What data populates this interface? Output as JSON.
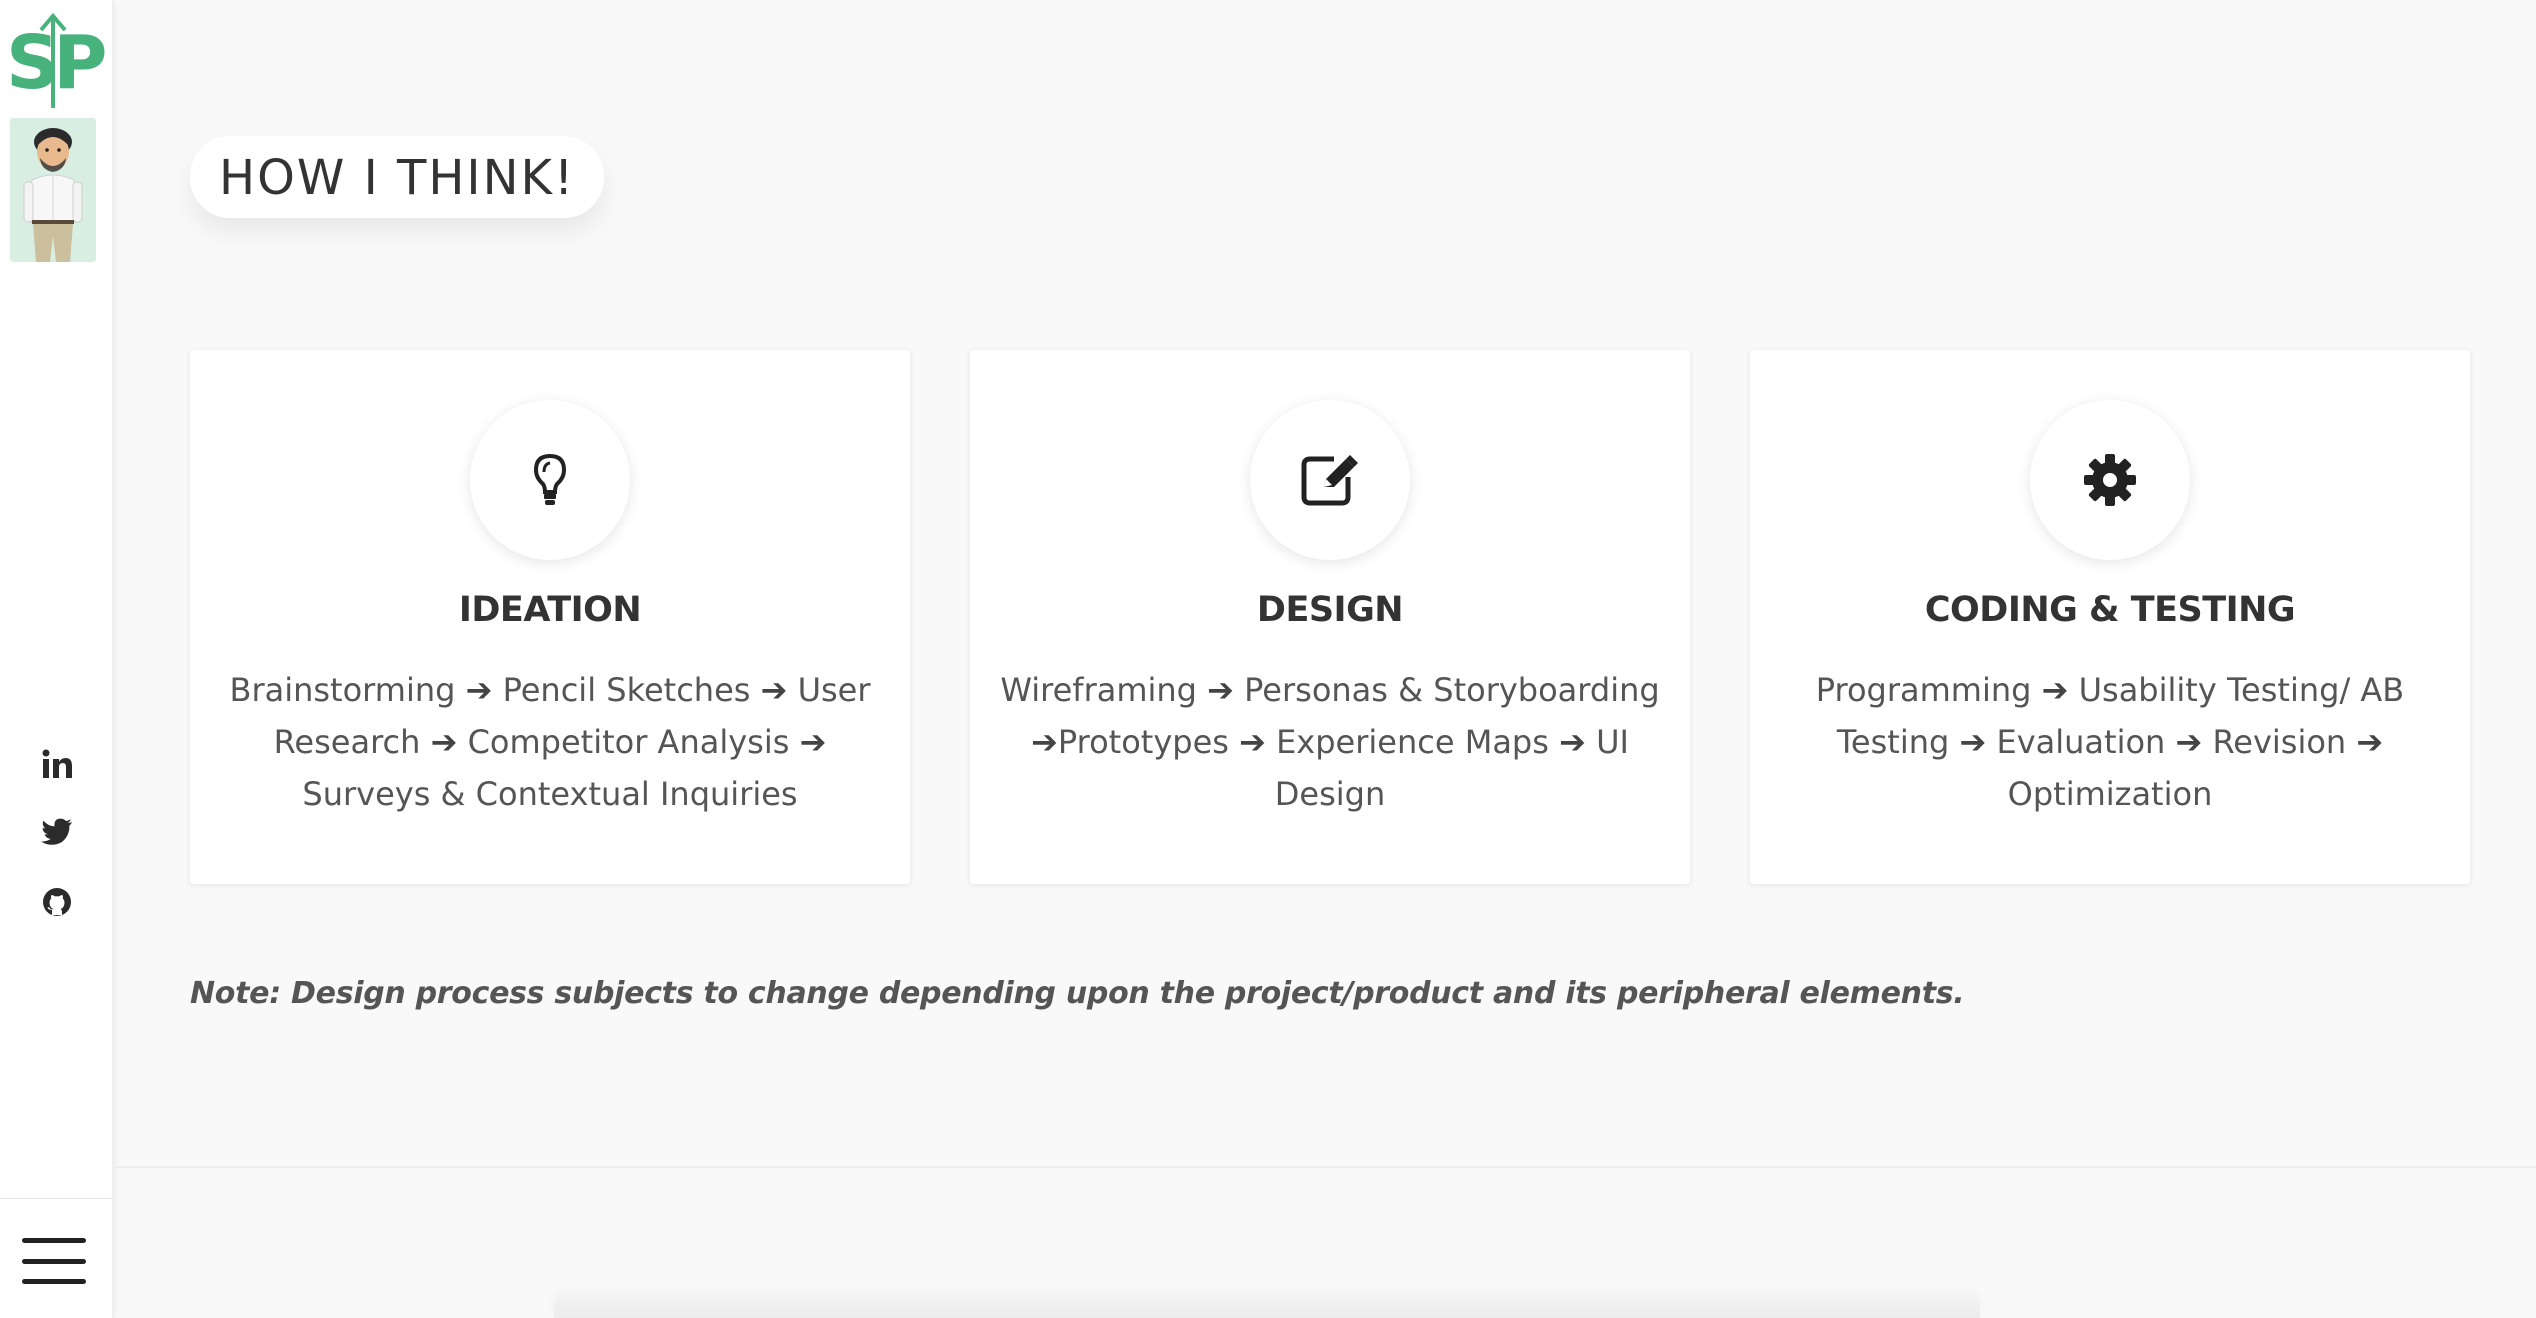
{
  "brand": {
    "logo_text": "SP",
    "accent_color": "#47b27b"
  },
  "sidebar": {
    "social": [
      {
        "name": "linkedin",
        "icon": "linkedin-icon"
      },
      {
        "name": "twitter",
        "icon": "twitter-icon"
      },
      {
        "name": "github",
        "icon": "github-icon"
      }
    ],
    "menu_icon": "hamburger-icon"
  },
  "section": {
    "heading": "HOW I THINK!"
  },
  "cards": [
    {
      "title": "IDEATION",
      "icon": "lightbulb-icon",
      "steps": [
        "Brainstorming",
        "Pencil Sketches",
        "User Research",
        "Competitor Analysis",
        "Surveys & Contextual Inquiries"
      ]
    },
    {
      "title": "DESIGN",
      "icon": "edit-icon",
      "steps": [
        "Wireframing",
        "Personas & Storyboarding",
        "Prototypes",
        "Experience Maps",
        "UI Design"
      ]
    },
    {
      "title": "CODING & TESTING",
      "icon": "gear-icon",
      "steps": [
        "Programming",
        "Usability Testing/ AB Testing",
        "Evaluation",
        "Revision",
        "Optimization"
      ]
    }
  ],
  "note": "Note: Design process subjects to change depending upon the project/product and its peripheral elements."
}
